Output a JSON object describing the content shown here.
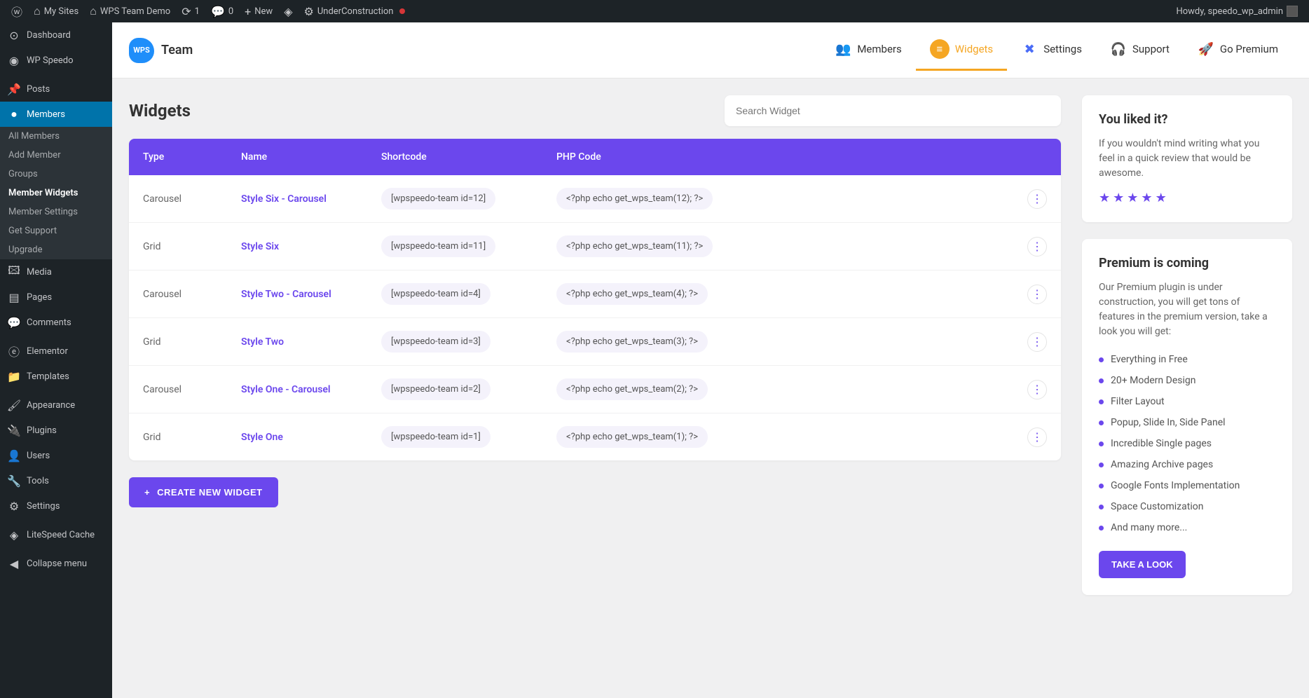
{
  "adminBar": {
    "mySites": "My Sites",
    "siteName": "WPS Team Demo",
    "updates": "1",
    "comments": "0",
    "new": "New",
    "underConstruction": "UnderConstruction",
    "howdy": "Howdy, speedo_wp_admin"
  },
  "sidebar": {
    "dashboard": "Dashboard",
    "wpSpeedo": "WP Speedo",
    "posts": "Posts",
    "members": "Members",
    "sub": {
      "allMembers": "All Members",
      "addMember": "Add Member",
      "groups": "Groups",
      "memberWidgets": "Member Widgets",
      "memberSettings": "Member Settings",
      "getSupport": "Get Support",
      "upgrade": "Upgrade"
    },
    "media": "Media",
    "pages": "Pages",
    "commentsItem": "Comments",
    "elementor": "Elementor",
    "templates": "Templates",
    "appearance": "Appearance",
    "plugins": "Plugins",
    "users": "Users",
    "tools": "Tools",
    "settings": "Settings",
    "litespeed": "LiteSpeed Cache",
    "collapse": "Collapse menu"
  },
  "pluginHeader": {
    "logo": "WPS",
    "brand": "Team",
    "nav": {
      "members": "Members",
      "widgets": "Widgets",
      "settings": "Settings",
      "support": "Support",
      "premium": "Go Premium"
    }
  },
  "page": {
    "title": "Widgets",
    "searchPlaceholder": "Search Widget",
    "createBtn": "CREATE NEW WIDGET",
    "columns": {
      "type": "Type",
      "name": "Name",
      "shortcode": "Shortcode",
      "php": "PHP Code"
    },
    "rows": [
      {
        "type": "Carousel",
        "name": "Style Six - Carousel",
        "shortcode": "[wpspeedo-team id=12]",
        "php": "<?php echo get_wps_team(12); ?>"
      },
      {
        "type": "Grid",
        "name": "Style Six",
        "shortcode": "[wpspeedo-team id=11]",
        "php": "<?php echo get_wps_team(11); ?>"
      },
      {
        "type": "Carousel",
        "name": "Style Two - Carousel",
        "shortcode": "[wpspeedo-team id=4]",
        "php": "<?php echo get_wps_team(4); ?>"
      },
      {
        "type": "Grid",
        "name": "Style Two",
        "shortcode": "[wpspeedo-team id=3]",
        "php": "<?php echo get_wps_team(3); ?>"
      },
      {
        "type": "Carousel",
        "name": "Style One - Carousel",
        "shortcode": "[wpspeedo-team id=2]",
        "php": "<?php echo get_wps_team(2); ?>"
      },
      {
        "type": "Grid",
        "name": "Style One",
        "shortcode": "[wpspeedo-team id=1]",
        "php": "<?php echo get_wps_team(1); ?>"
      }
    ]
  },
  "likedPanel": {
    "title": "You liked it?",
    "text": "If you wouldn't mind writing what you feel in a quick review that would be awesome."
  },
  "premiumPanel": {
    "title": "Premium is coming",
    "text": "Our Premium plugin is under construction, you will get tons of features in the premium version, take a look you will get:",
    "features": [
      "Everything in Free",
      "20+ Modern Design",
      "Filter Layout",
      "Popup, Slide In, Side Panel",
      "Incredible Single pages",
      "Amazing Archive pages",
      "Google Fonts Implementation",
      "Space Customization",
      "And many more..."
    ],
    "btn": "TAKE A LOOK"
  }
}
